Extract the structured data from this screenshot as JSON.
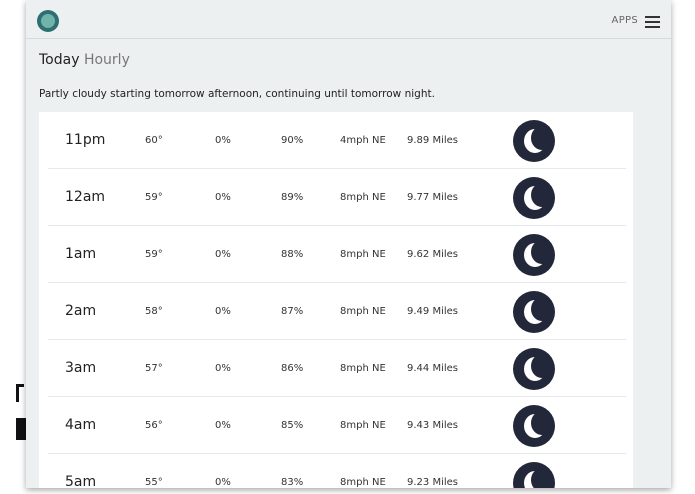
{
  "header": {
    "apps_label": "APPS"
  },
  "title": {
    "main": "Today",
    "sub": "Hourly"
  },
  "summary": "Partly cloudy starting tomorrow afternoon, continuing until tomorrow night.",
  "icon_names": {
    "logo": "app-logo-icon",
    "menu": "hamburger-menu-icon",
    "condition": "clear-night-moon-icon"
  },
  "colors": {
    "moon_bg": "#23273a",
    "logo": "#2f6f73",
    "panel_bg": "#edf0f1"
  },
  "hours": [
    {
      "time": "11pm",
      "temp": "60°",
      "precip": "0%",
      "humidity": "90%",
      "wind": "4mph NE",
      "visibility": "9.89 Miles"
    },
    {
      "time": "12am",
      "temp": "59°",
      "precip": "0%",
      "humidity": "89%",
      "wind": "8mph NE",
      "visibility": "9.77 Miles"
    },
    {
      "time": "1am",
      "temp": "59°",
      "precip": "0%",
      "humidity": "88%",
      "wind": "8mph NE",
      "visibility": "9.62 Miles"
    },
    {
      "time": "2am",
      "temp": "58°",
      "precip": "0%",
      "humidity": "87%",
      "wind": "8mph NE",
      "visibility": "9.49 Miles"
    },
    {
      "time": "3am",
      "temp": "57°",
      "precip": "0%",
      "humidity": "86%",
      "wind": "8mph NE",
      "visibility": "9.44 Miles"
    },
    {
      "time": "4am",
      "temp": "56°",
      "precip": "0%",
      "humidity": "85%",
      "wind": "8mph NE",
      "visibility": "9.43 Miles"
    },
    {
      "time": "5am",
      "temp": "55°",
      "precip": "0%",
      "humidity": "83%",
      "wind": "8mph NE",
      "visibility": "9.23 Miles"
    }
  ]
}
